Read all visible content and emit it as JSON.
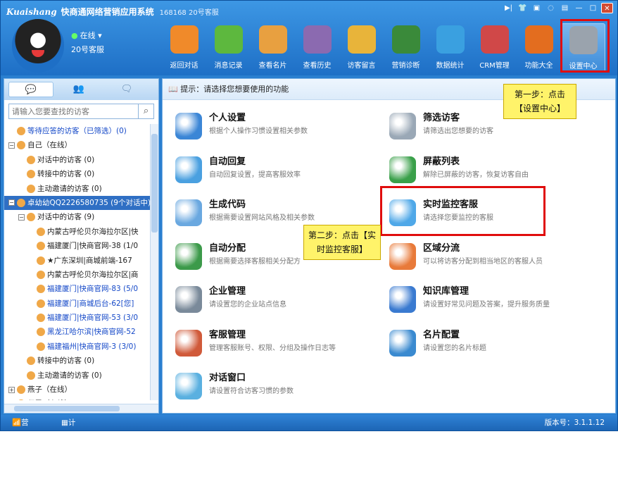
{
  "app": {
    "logo": "Kuaishang",
    "title": "快商通网络营销应用系统",
    "account": "168168 20号客服"
  },
  "user": {
    "status": "在线",
    "name": "20号客服"
  },
  "toolbar": [
    {
      "label": "返回对话",
      "icon": "back-arrow-icon",
      "color": "#f08a2a"
    },
    {
      "label": "消息记录",
      "icon": "message-icon",
      "color": "#5db83e"
    },
    {
      "label": "查看名片",
      "icon": "business-card-icon",
      "color": "#e8a040"
    },
    {
      "label": "查看历史",
      "icon": "history-search-icon",
      "color": "#8b6ab0"
    },
    {
      "label": "访客留言",
      "icon": "guest-message-icon",
      "color": "#e8b43a"
    },
    {
      "label": "营销诊断",
      "icon": "diagnosis-chart-icon",
      "color": "#3a8a3a"
    },
    {
      "label": "数据统计",
      "icon": "pie-chart-icon",
      "color": "#3aa0e0"
    },
    {
      "label": "CRM管理",
      "icon": "crm-people-icon",
      "color": "#d04848"
    },
    {
      "label": "功能大全",
      "icon": "toolbox-icon",
      "color": "#e36d1f"
    },
    {
      "label": "设置中心",
      "icon": "gear-icon",
      "color": "#9aa3ad"
    }
  ],
  "left_tabs": [
    "💬",
    "👥",
    "🗨"
  ],
  "search": {
    "placeholder": "请输入您要查找的访客"
  },
  "tree": [
    {
      "text": "等待应答的访客（已筛选）(0)",
      "level": 0,
      "exp": "",
      "cls": "blue"
    },
    {
      "text": "自己（在线）",
      "level": 0,
      "exp": "−",
      "cls": ""
    },
    {
      "text": "对话中的访客 (0)",
      "level": 1,
      "exp": "",
      "cls": ""
    },
    {
      "text": "转接中的访客 (0)",
      "level": 1,
      "exp": "",
      "cls": ""
    },
    {
      "text": "主动邀请的访客 (0)",
      "level": 1,
      "exp": "",
      "cls": ""
    },
    {
      "text": "卓幼幼QQ2226580735 (9个对话中)",
      "level": 0,
      "exp": "−",
      "cls": "sel"
    },
    {
      "text": "对话中的访客 (9)",
      "level": 1,
      "exp": "−",
      "cls": ""
    },
    {
      "text": "内蒙古呼伦贝尔海拉尔区|快",
      "level": 2,
      "exp": "",
      "cls": ""
    },
    {
      "text": "福建厦门|快商官网-38 (1/0",
      "level": 2,
      "exp": "",
      "cls": ""
    },
    {
      "text": "★广东深圳|商城前端-167",
      "level": 2,
      "exp": "",
      "cls": ""
    },
    {
      "text": "内蒙古呼伦贝尔海拉尔区|商",
      "level": 2,
      "exp": "",
      "cls": ""
    },
    {
      "text": "福建厦门|快商官网-83 (5/0",
      "level": 2,
      "exp": "",
      "cls": "blue"
    },
    {
      "text": "福建厦门|商城后台-62[您]",
      "level": 2,
      "exp": "",
      "cls": "blue"
    },
    {
      "text": "福建厦门|快商官网-53 (3/0",
      "level": 2,
      "exp": "",
      "cls": "blue"
    },
    {
      "text": "黑龙江哈尔滨|快商官网-52",
      "level": 2,
      "exp": "",
      "cls": "blue"
    },
    {
      "text": "福建福州|快商官网-3 (3/0)",
      "level": 2,
      "exp": "",
      "cls": "blue"
    },
    {
      "text": "转接中的访客 (0)",
      "level": 1,
      "exp": "",
      "cls": ""
    },
    {
      "text": "主动邀请的访客 (0)",
      "level": 1,
      "exp": "",
      "cls": ""
    },
    {
      "text": "燕子（在线）",
      "level": 0,
      "exp": "+",
      "cls": ""
    },
    {
      "text": "程霞（在线）",
      "level": 0,
      "exp": "+",
      "cls": ""
    }
  ],
  "tip": "提示：请选择您想要使用的功能",
  "functions": [
    {
      "title": "个人设置",
      "desc": "根据个人操作习惯设置相关参数",
      "icon": "user-settings-icon",
      "color": "#3b86d6"
    },
    {
      "title": "筛选访客",
      "desc": "请筛选出您想要的访客",
      "icon": "magnifier-icon",
      "color": "#9aa8b6"
    },
    {
      "title": "自动回复",
      "desc": "自动回复设置，提高客服效率",
      "icon": "auto-reply-icon",
      "color": "#4aa0e0"
    },
    {
      "title": "屏蔽列表",
      "desc": "解除已屏蔽的访客，恢复访客自由",
      "icon": "shield-icon",
      "color": "#3aa04a"
    },
    {
      "title": "生成代码",
      "desc": "根据需要设置网站风格及相关参数",
      "icon": "code-window-icon",
      "color": "#6aa8e0"
    },
    {
      "title": "实时监控客服",
      "desc": "请选择您要监控的客服",
      "icon": "webcam-icon",
      "color": "#4fa8e8"
    },
    {
      "title": "自动分配",
      "desc": "根据需要选择客服相关分配方",
      "icon": "auto-assign-icon",
      "color": "#3c9a4a"
    },
    {
      "title": "区域分流",
      "desc": "可以将访客分配到相当地区的客服人员",
      "icon": "region-split-icon",
      "color": "#e87a3a"
    },
    {
      "title": "企业管理",
      "desc": "请设置您的企业站点信息",
      "icon": "building-icon",
      "color": "#7a8a9a"
    },
    {
      "title": "知识库管理",
      "desc": "请设置好常见问题及答案，提升服务质量",
      "icon": "books-icon",
      "color": "#3a7ad0"
    },
    {
      "title": "客服管理",
      "desc": "管理客服账号、权限、分组及操作日志等",
      "icon": "staff-management-icon",
      "color": "#d05a3a"
    },
    {
      "title": "名片配置",
      "desc": "请设置您的名片标题",
      "icon": "name-card-icon",
      "color": "#3a8ad0"
    },
    {
      "title": "对话窗口",
      "desc": "请设置符合访客习惯的参数",
      "icon": "chat-window-icon",
      "color": "#5ab0e0"
    }
  ],
  "callouts": {
    "step1": "第一步：点击【设置中心】",
    "step2": "第二步：点击【实时监控客服】"
  },
  "statusbar": {
    "marketing": "营销指数",
    "calculator": "计算器",
    "version": "版本号：3.1.1.12"
  }
}
